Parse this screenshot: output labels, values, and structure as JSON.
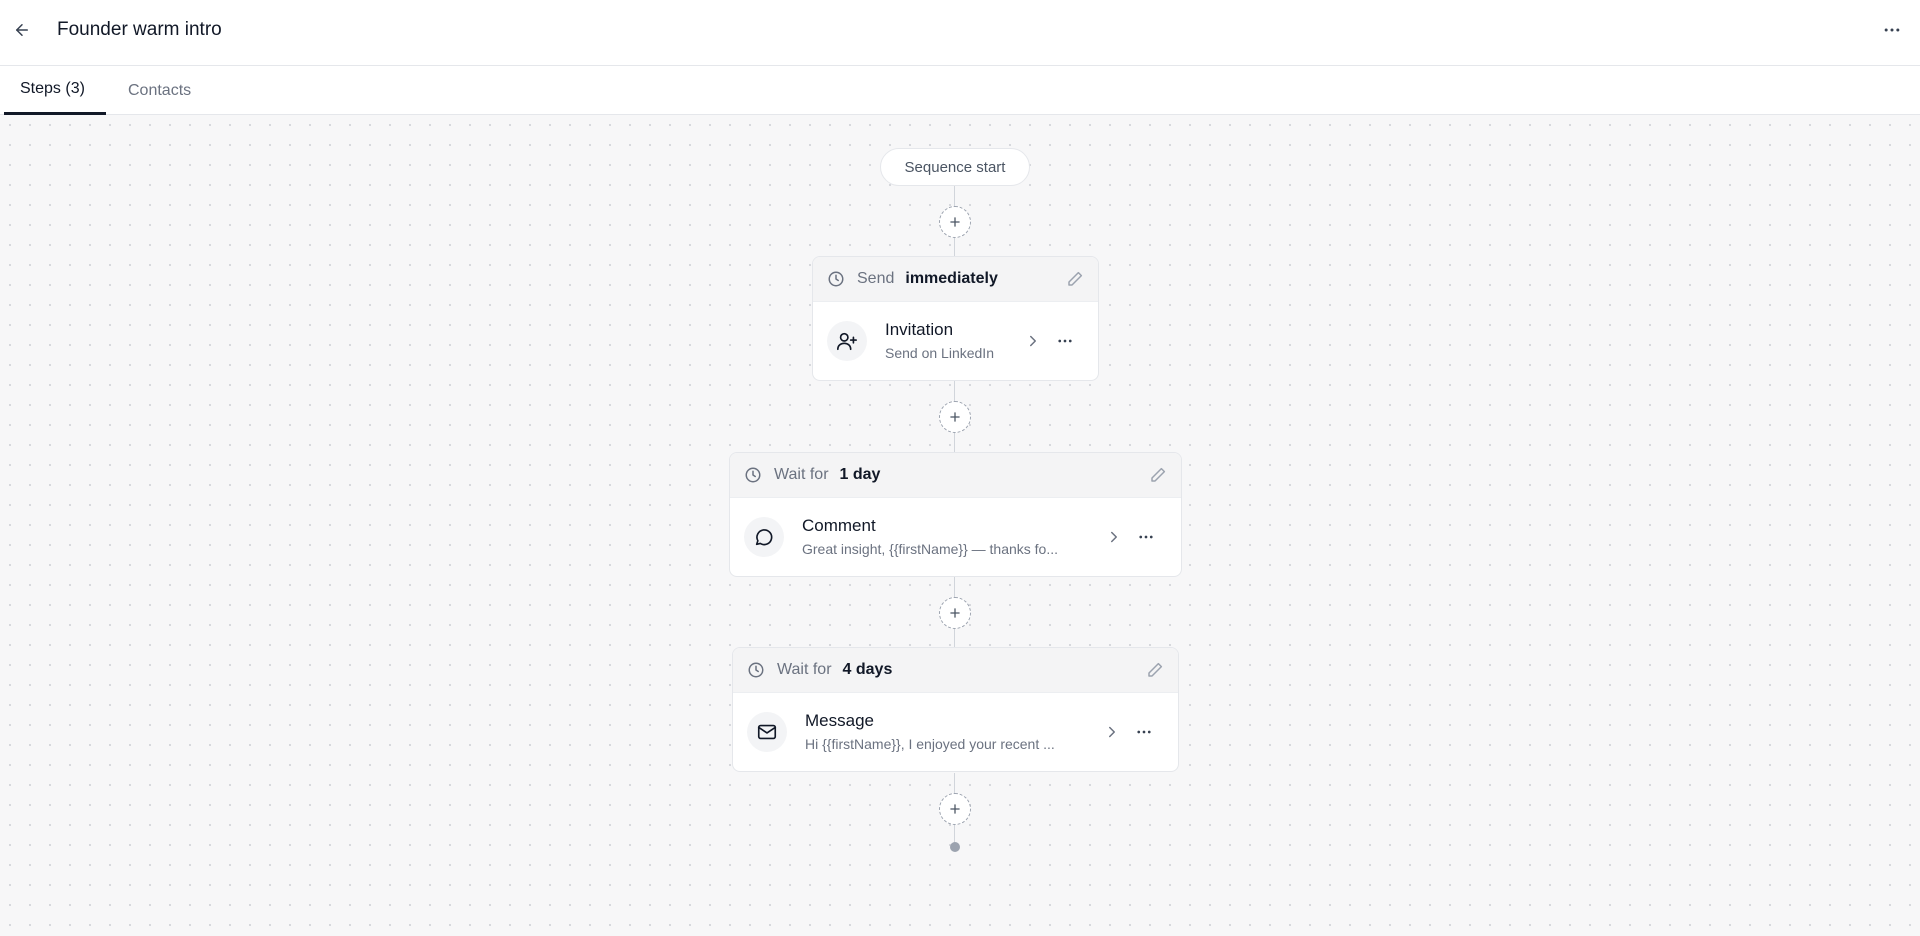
{
  "header": {
    "title": "Founder warm intro",
    "back_icon": "arrow-left-icon",
    "more_icon": "more-horizontal-icon"
  },
  "tabs": [
    {
      "label": "Steps (3)",
      "active": true
    },
    {
      "label": "Contacts",
      "active": false
    }
  ],
  "flow": {
    "start_label": "Sequence start",
    "steps": [
      {
        "timing_prefix": "Send",
        "timing_value": "immediately",
        "icon": "user-plus-icon",
        "title": "Invitation",
        "subtitle": "Send on LinkedIn"
      },
      {
        "timing_prefix": "Wait for",
        "timing_value": "1 day",
        "icon": "message-circle-icon",
        "title": "Comment",
        "subtitle": "Great insight, {{firstName}} — thanks fo..."
      },
      {
        "timing_prefix": "Wait for",
        "timing_value": "4 days",
        "icon": "mail-icon",
        "title": "Message",
        "subtitle": "Hi {{firstName}}, I enjoyed your recent ..."
      }
    ]
  },
  "colors": {
    "canvas_bg": "#f7f7f8",
    "card_header_bg": "#f4f4f5",
    "border": "#e5e7eb",
    "text_primary": "#111827",
    "text_secondary": "#6b7280"
  }
}
